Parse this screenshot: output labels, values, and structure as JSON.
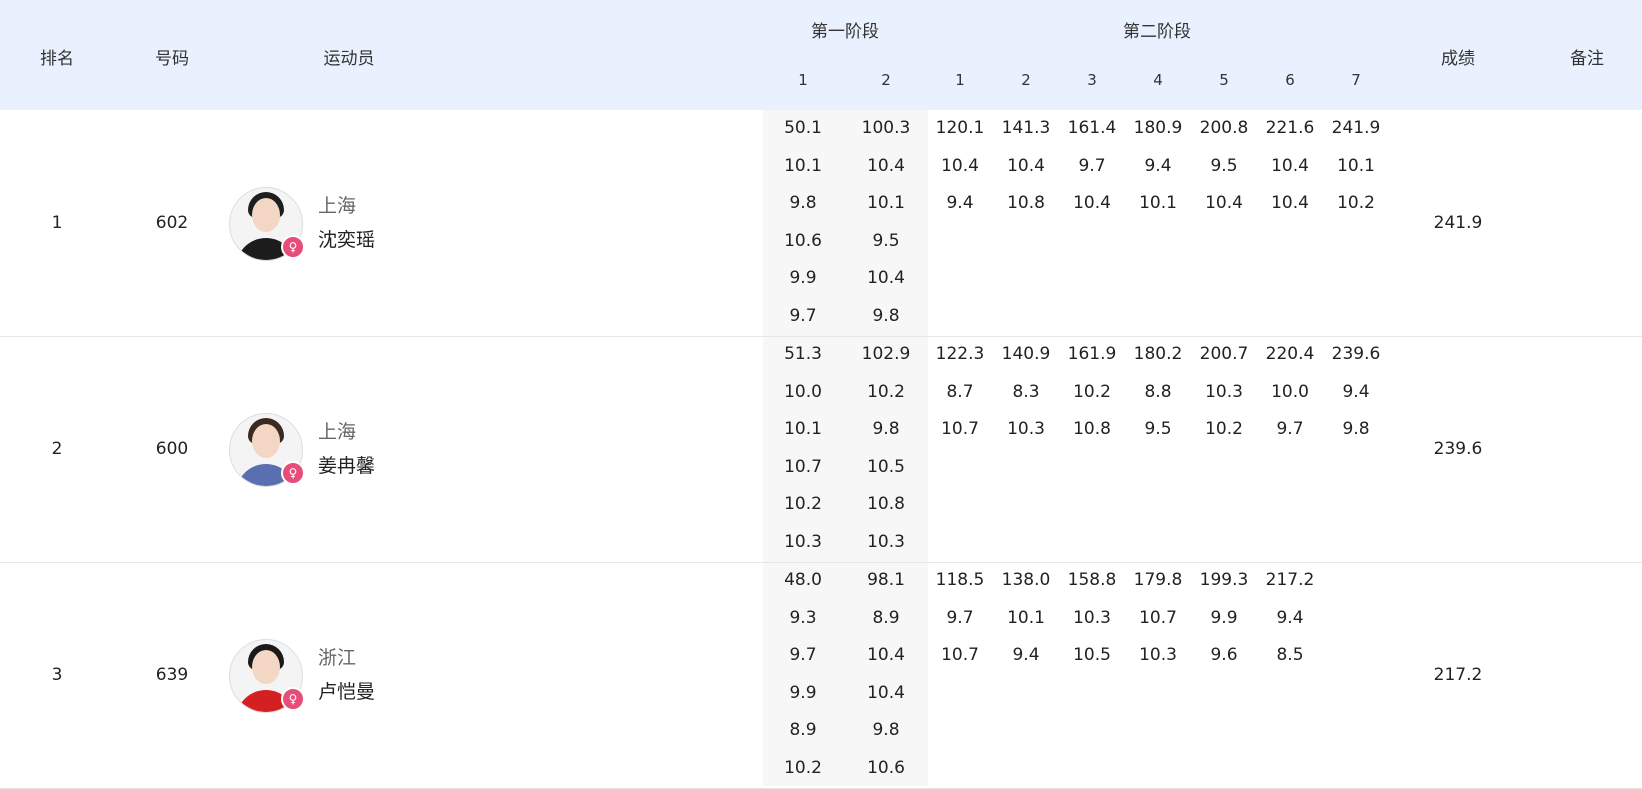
{
  "header": {
    "rank": "排名",
    "number": "号码",
    "athlete": "运动员",
    "stage1": "第一阶段",
    "stage2": "第二阶段",
    "result": "成绩",
    "remark": "备注",
    "stage1_cols": [
      "1",
      "2"
    ],
    "stage2_cols": [
      "1",
      "2",
      "3",
      "4",
      "5",
      "6",
      "7"
    ]
  },
  "rows": [
    {
      "rank": "1",
      "number": "602",
      "team": "上海",
      "name": "沈奕瑶",
      "result": "241.9",
      "avatar_colors": {
        "hair": "#1e1e1e",
        "body": "#1c1c1c"
      },
      "stage1": [
        [
          "50.1",
          "10.1",
          "9.8",
          "10.6",
          "9.9",
          "9.7"
        ],
        [
          "100.3",
          "10.4",
          "10.1",
          "9.5",
          "10.4",
          "9.8"
        ]
      ],
      "stage2": [
        [
          "120.1",
          "10.4",
          "9.4"
        ],
        [
          "141.3",
          "10.4",
          "10.8"
        ],
        [
          "161.4",
          "9.7",
          "10.4"
        ],
        [
          "180.9",
          "9.4",
          "10.1"
        ],
        [
          "200.8",
          "9.5",
          "10.4"
        ],
        [
          "221.6",
          "10.4",
          "10.4"
        ],
        [
          "241.9",
          "10.1",
          "10.2"
        ]
      ]
    },
    {
      "rank": "2",
      "number": "600",
      "team": "上海",
      "name": "姜冉馨",
      "result": "239.6",
      "avatar_colors": {
        "hair": "#3a2a20",
        "body": "#5a6fb0"
      },
      "stage1": [
        [
          "51.3",
          "10.0",
          "10.1",
          "10.7",
          "10.2",
          "10.3"
        ],
        [
          "102.9",
          "10.2",
          "9.8",
          "10.5",
          "10.8",
          "10.3"
        ]
      ],
      "stage2": [
        [
          "122.3",
          "8.7",
          "10.7"
        ],
        [
          "140.9",
          "8.3",
          "10.3"
        ],
        [
          "161.9",
          "10.2",
          "10.8"
        ],
        [
          "180.2",
          "8.8",
          "9.5"
        ],
        [
          "200.7",
          "10.3",
          "10.2"
        ],
        [
          "220.4",
          "10.0",
          "9.7"
        ],
        [
          "239.6",
          "9.4",
          "9.8"
        ]
      ]
    },
    {
      "rank": "3",
      "number": "639",
      "team": "浙江",
      "name": "卢恺曼",
      "result": "217.2",
      "avatar_colors": {
        "hair": "#1a1a1a",
        "body": "#d42020"
      },
      "stage1": [
        [
          "48.0",
          "9.3",
          "9.7",
          "9.9",
          "8.9",
          "10.2"
        ],
        [
          "98.1",
          "8.9",
          "10.4",
          "10.4",
          "9.8",
          "10.6"
        ]
      ],
      "stage2": [
        [
          "118.5",
          "9.7",
          "10.7"
        ],
        [
          "138.0",
          "10.1",
          "9.4"
        ],
        [
          "158.8",
          "10.3",
          "10.5"
        ],
        [
          "179.8",
          "10.7",
          "10.3"
        ],
        [
          "199.3",
          "9.9",
          "9.6"
        ],
        [
          "217.2",
          "9.4",
          "8.5"
        ]
      ]
    }
  ],
  "badge_symbol": "♀",
  "colors": {
    "header_bg": "#e8f1fd",
    "badge": "#e84d7a",
    "stage1_bg": "#f7f7f7"
  }
}
